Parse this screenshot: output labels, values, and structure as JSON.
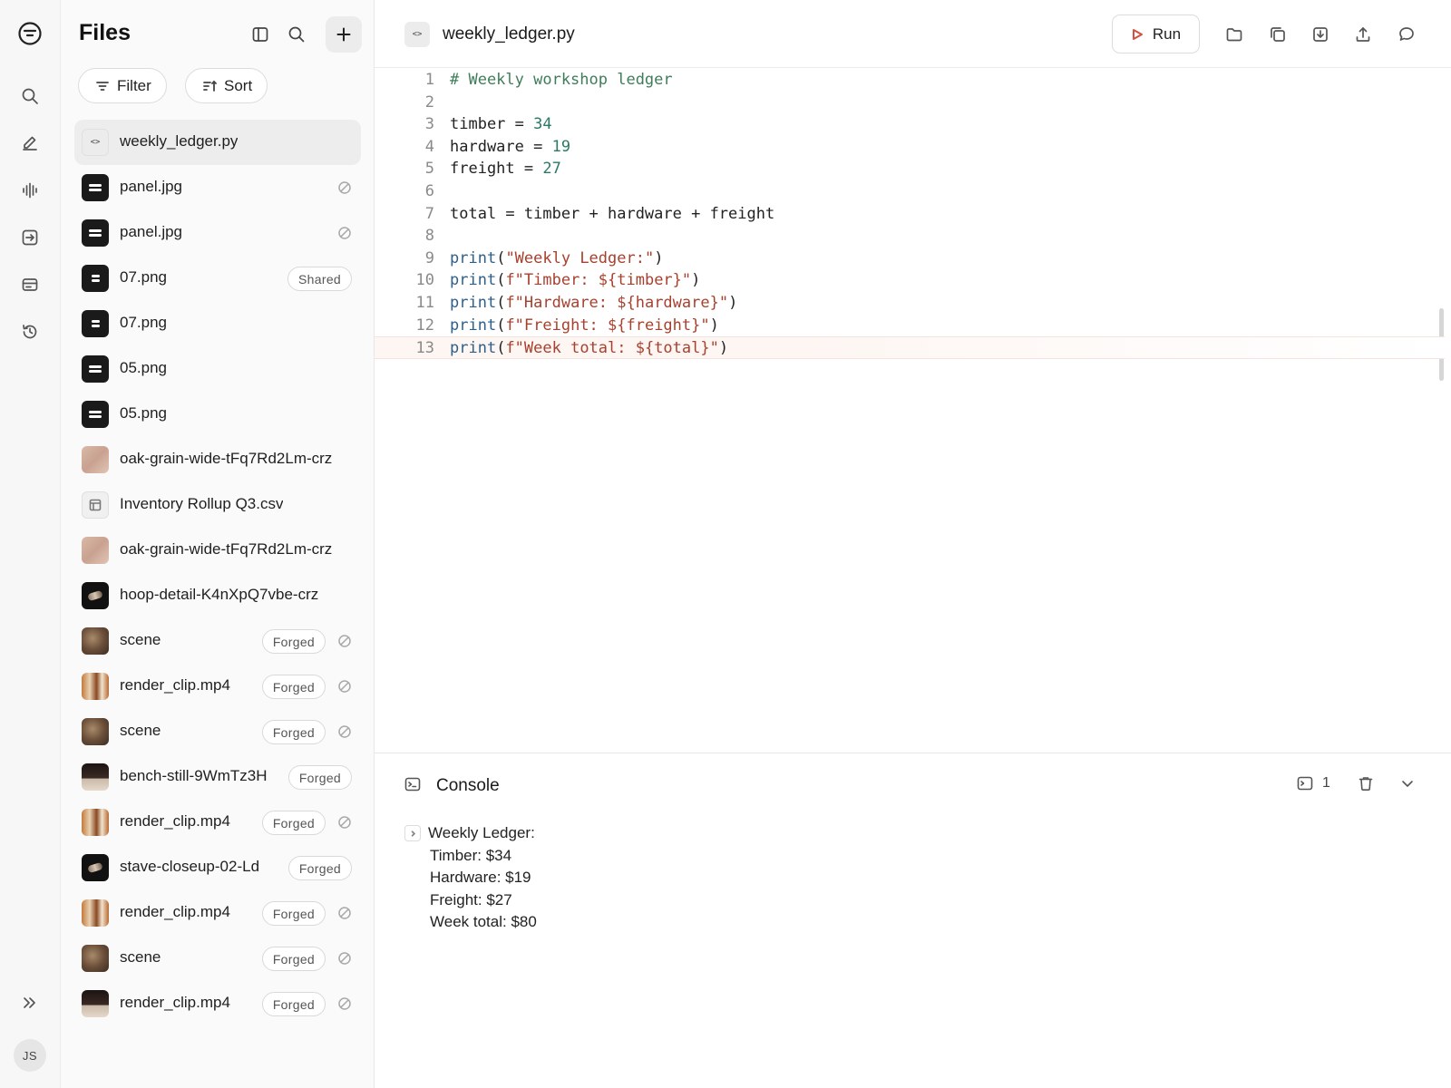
{
  "rail": {
    "avatar_initials": "JS",
    "icons": [
      "logo-icon",
      "search-icon",
      "edit-icon",
      "audio-icon",
      "import-icon",
      "card-icon",
      "history-icon",
      "expand-icon"
    ]
  },
  "files_panel": {
    "title": "Files",
    "filter_label": "Filter",
    "sort_label": "Sort",
    "items": [
      {
        "name": "weekly_ledger.py",
        "thumb": "code",
        "badge": "",
        "blocked": false,
        "active": true
      },
      {
        "name": "panel.jpg",
        "thumb": "dark",
        "badge": "",
        "blocked": true
      },
      {
        "name": "panel.jpg",
        "thumb": "dark",
        "badge": "",
        "blocked": true
      },
      {
        "name": "07.png",
        "thumb": "dark-small",
        "badge": "Shared",
        "blocked": false
      },
      {
        "name": "07.png",
        "thumb": "dark-small",
        "badge": "",
        "blocked": false
      },
      {
        "name": "05.png",
        "thumb": "dark",
        "badge": "",
        "blocked": false
      },
      {
        "name": "05.png",
        "thumb": "dark",
        "badge": "",
        "blocked": false
      },
      {
        "name": "oak-grain-wide-tFq7Rd2Lm-crz",
        "thumb": "wood",
        "badge": "",
        "blocked": false
      },
      {
        "name": "Inventory Rollup Q3.csv",
        "thumb": "csv",
        "badge": "",
        "blocked": false
      },
      {
        "name": "oak-grain-wide-tFq7Rd2Lm-crz",
        "thumb": "wood",
        "badge": "",
        "blocked": false
      },
      {
        "name": "hoop-detail-K4nXpQ7vbe-crz",
        "thumb": "hoop",
        "badge": "",
        "blocked": false
      },
      {
        "name": "scene",
        "thumb": "scene",
        "badge": "Forged",
        "blocked": true
      },
      {
        "name": "render_clip.mp4",
        "thumb": "clip",
        "badge": "Forged",
        "blocked": true
      },
      {
        "name": "scene",
        "thumb": "scene",
        "badge": "Forged",
        "blocked": true
      },
      {
        "name": "bench-still-9WmTz3H",
        "thumb": "bench",
        "badge": "Forged",
        "blocked": false
      },
      {
        "name": "render_clip.mp4",
        "thumb": "clip",
        "badge": "Forged",
        "blocked": true
      },
      {
        "name": "stave-closeup-02-Ld",
        "thumb": "hoop",
        "badge": "Forged",
        "blocked": false
      },
      {
        "name": "render_clip.mp4",
        "thumb": "clip",
        "badge": "Forged",
        "blocked": true
      },
      {
        "name": "scene",
        "thumb": "scene",
        "badge": "Forged",
        "blocked": true
      },
      {
        "name": "render_clip.mp4",
        "thumb": "bench",
        "badge": "Forged",
        "blocked": true
      }
    ]
  },
  "editor": {
    "filename": "weekly_ledger.py",
    "run_label": "Run",
    "current_line": 13,
    "colors": {
      "comment": "#3f7d5a",
      "number": "#2a7a66",
      "string": "#a8402e",
      "builtin": "#2d5f8b",
      "plain": "#222222"
    },
    "lines": [
      [
        {
          "t": "# Weekly workshop ledger",
          "c": "comment"
        }
      ],
      [],
      [
        {
          "t": "timber = ",
          "c": "plain"
        },
        {
          "t": "34",
          "c": "number"
        }
      ],
      [
        {
          "t": "hardware = ",
          "c": "plain"
        },
        {
          "t": "19",
          "c": "number"
        }
      ],
      [
        {
          "t": "freight = ",
          "c": "plain"
        },
        {
          "t": "27",
          "c": "number"
        }
      ],
      [],
      [
        {
          "t": "total = timber + hardware + freight",
          "c": "plain"
        }
      ],
      [],
      [
        {
          "t": "print",
          "c": "builtin"
        },
        {
          "t": "(",
          "c": "plain"
        },
        {
          "t": "\"Weekly Ledger:\"",
          "c": "string"
        },
        {
          "t": ")",
          "c": "plain"
        }
      ],
      [
        {
          "t": "print",
          "c": "builtin"
        },
        {
          "t": "(",
          "c": "plain"
        },
        {
          "t": "f\"Timber: ${timber}\"",
          "c": "string"
        },
        {
          "t": ")",
          "c": "plain"
        }
      ],
      [
        {
          "t": "print",
          "c": "builtin"
        },
        {
          "t": "(",
          "c": "plain"
        },
        {
          "t": "f\"Hardware: ${hardware}\"",
          "c": "string"
        },
        {
          "t": ")",
          "c": "plain"
        }
      ],
      [
        {
          "t": "print",
          "c": "builtin"
        },
        {
          "t": "(",
          "c": "plain"
        },
        {
          "t": "f\"Freight: ${freight}\"",
          "c": "string"
        },
        {
          "t": ")",
          "c": "plain"
        }
      ],
      [
        {
          "t": "print",
          "c": "builtin"
        },
        {
          "t": "(",
          "c": "plain"
        },
        {
          "t": "f\"Week total: ${total}\"",
          "c": "string"
        },
        {
          "t": ")",
          "c": "plain"
        }
      ]
    ]
  },
  "console": {
    "title": "Console",
    "message_count": "1",
    "output": [
      "Weekly Ledger:",
      "Timber: $34",
      "Hardware: $19",
      "Freight: $27",
      "Week total: $80"
    ]
  }
}
